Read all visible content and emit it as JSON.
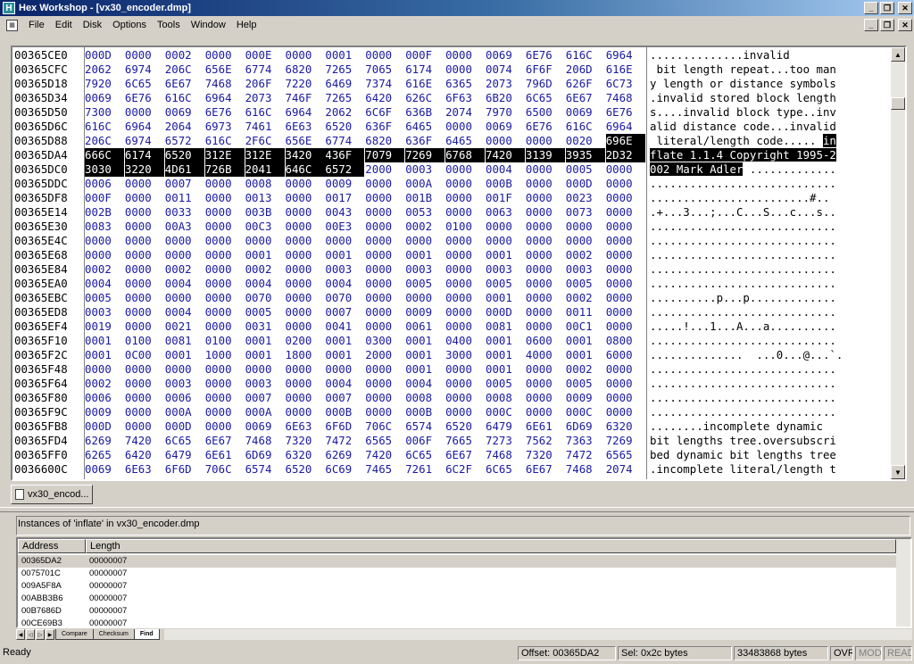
{
  "window": {
    "title": "Hex Workshop - [vx30_encoder.dmp]"
  },
  "menu": [
    "File",
    "Edit",
    "Disk",
    "Options",
    "Tools",
    "Window",
    "Help"
  ],
  "hex": {
    "rows": [
      {
        "addr": "00365CE0",
        "words": [
          "000D",
          "0000",
          "0002",
          "0000",
          "000E",
          "0000",
          "0001",
          "0000",
          "000F",
          "0000",
          "0069",
          "6E76",
          "616C",
          "6964"
        ],
        "ascii": "..............invalid"
      },
      {
        "addr": "00365CFC",
        "words": [
          "2062",
          "6974",
          "206C",
          "656E",
          "6774",
          "6820",
          "7265",
          "7065",
          "6174",
          "0000",
          "0074",
          "6F6F",
          "206D",
          "616E"
        ],
        "ascii": " bit length repeat...too man"
      },
      {
        "addr": "00365D18",
        "words": [
          "7920",
          "6C65",
          "6E67",
          "7468",
          "206F",
          "7220",
          "6469",
          "7374",
          "616E",
          "6365",
          "2073",
          "796D",
          "626F",
          "6C73"
        ],
        "ascii": "y length or distance symbols"
      },
      {
        "addr": "00365D34",
        "words": [
          "0069",
          "6E76",
          "616C",
          "6964",
          "2073",
          "746F",
          "7265",
          "6420",
          "626C",
          "6F63",
          "6B20",
          "6C65",
          "6E67",
          "7468"
        ],
        "ascii": ".invalid stored block length"
      },
      {
        "addr": "00365D50",
        "words": [
          "7300",
          "0000",
          "0069",
          "6E76",
          "616C",
          "6964",
          "2062",
          "6C6F",
          "636B",
          "2074",
          "7970",
          "6500",
          "0069",
          "6E76"
        ],
        "ascii": "s....invalid block type..inv"
      },
      {
        "addr": "00365D6C",
        "words": [
          "616C",
          "6964",
          "2064",
          "6973",
          "7461",
          "6E63",
          "6520",
          "636F",
          "6465",
          "0000",
          "0069",
          "6E76",
          "616C",
          "6964"
        ],
        "ascii": "alid distance code...invalid"
      },
      {
        "addr": "00365D88",
        "words": [
          "206C",
          "6974",
          "6572",
          "616C",
          "2F6C",
          "656E",
          "6774",
          "6820",
          "636F",
          "6465",
          "0000",
          "0000",
          "0020",
          "696E"
        ],
        "ascii": " literal/length code..... ",
        "ascii_sel": "in"
      },
      {
        "addr": "00365DA4",
        "words": [
          "666C",
          "6174",
          "6520",
          "312E",
          "312E",
          "3420",
          "436F",
          "7079",
          "7269",
          "6768",
          "7420",
          "3139",
          "3935",
          "2D32"
        ],
        "ascii": "",
        "ascii_sel": "flate 1.1.4 Copyright 1995-2"
      },
      {
        "addr": "00365DC0",
        "words": [
          "3030",
          "3220",
          "4D61",
          "726B",
          "2041",
          "646C",
          "6572",
          "2000",
          "0003",
          "0000",
          "0004",
          "0000",
          "0005",
          "0000"
        ],
        "ascii_sel": "002 Mark Adler",
        "ascii": " ............."
      },
      {
        "addr": "00365DDC",
        "words": [
          "0006",
          "0000",
          "0007",
          "0000",
          "0008",
          "0000",
          "0009",
          "0000",
          "000A",
          "0000",
          "000B",
          "0000",
          "000D",
          "0000"
        ],
        "ascii": "............................"
      },
      {
        "addr": "00365DF8",
        "words": [
          "000F",
          "0000",
          "0011",
          "0000",
          "0013",
          "0000",
          "0017",
          "0000",
          "001B",
          "0000",
          "001F",
          "0000",
          "0023",
          "0000"
        ],
        "ascii": "........................#.."
      },
      {
        "addr": "00365E14",
        "words": [
          "002B",
          "0000",
          "0033",
          "0000",
          "003B",
          "0000",
          "0043",
          "0000",
          "0053",
          "0000",
          "0063",
          "0000",
          "0073",
          "0000"
        ],
        "ascii": ".+...3...;...C...S...c...s.."
      },
      {
        "addr": "00365E30",
        "words": [
          "0083",
          "0000",
          "00A3",
          "0000",
          "00C3",
          "0000",
          "00E3",
          "0000",
          "0002",
          "0100",
          "0000",
          "0000",
          "0000",
          "0000"
        ],
        "ascii": "............................"
      },
      {
        "addr": "00365E4C",
        "words": [
          "0000",
          "0000",
          "0000",
          "0000",
          "0000",
          "0000",
          "0000",
          "0000",
          "0000",
          "0000",
          "0000",
          "0000",
          "0000",
          "0000"
        ],
        "ascii": "............................"
      },
      {
        "addr": "00365E68",
        "words": [
          "0000",
          "0000",
          "0000",
          "0000",
          "0001",
          "0000",
          "0001",
          "0000",
          "0001",
          "0000",
          "0001",
          "0000",
          "0002",
          "0000"
        ],
        "ascii": "............................"
      },
      {
        "addr": "00365E84",
        "words": [
          "0002",
          "0000",
          "0002",
          "0000",
          "0002",
          "0000",
          "0003",
          "0000",
          "0003",
          "0000",
          "0003",
          "0000",
          "0003",
          "0000"
        ],
        "ascii": "............................"
      },
      {
        "addr": "00365EA0",
        "words": [
          "0004",
          "0000",
          "0004",
          "0000",
          "0004",
          "0000",
          "0004",
          "0000",
          "0005",
          "0000",
          "0005",
          "0000",
          "0005",
          "0000"
        ],
        "ascii": "............................"
      },
      {
        "addr": "00365EBC",
        "words": [
          "0005",
          "0000",
          "0000",
          "0000",
          "0070",
          "0000",
          "0070",
          "0000",
          "0000",
          "0000",
          "0001",
          "0000",
          "0002",
          "0000"
        ],
        "ascii": "..........p...p............."
      },
      {
        "addr": "00365ED8",
        "words": [
          "0003",
          "0000",
          "0004",
          "0000",
          "0005",
          "0000",
          "0007",
          "0000",
          "0009",
          "0000",
          "000D",
          "0000",
          "0011",
          "0000"
        ],
        "ascii": "............................"
      },
      {
        "addr": "00365EF4",
        "words": [
          "0019",
          "0000",
          "0021",
          "0000",
          "0031",
          "0000",
          "0041",
          "0000",
          "0061",
          "0000",
          "0081",
          "0000",
          "00C1",
          "0000"
        ],
        "ascii": ".....!...1...A...a.........."
      },
      {
        "addr": "00365F10",
        "words": [
          "0001",
          "0100",
          "0081",
          "0100",
          "0001",
          "0200",
          "0001",
          "0300",
          "0001",
          "0400",
          "0001",
          "0600",
          "0001",
          "0800"
        ],
        "ascii": "............................"
      },
      {
        "addr": "00365F2C",
        "words": [
          "0001",
          "0C00",
          "0001",
          "1000",
          "0001",
          "1800",
          "0001",
          "2000",
          "0001",
          "3000",
          "0001",
          "4000",
          "0001",
          "6000"
        ],
        "ascii": "..............  ...0...@...`."
      },
      {
        "addr": "00365F48",
        "words": [
          "0000",
          "0000",
          "0000",
          "0000",
          "0000",
          "0000",
          "0000",
          "0000",
          "0001",
          "0000",
          "0001",
          "0000",
          "0002",
          "0000"
        ],
        "ascii": "............................"
      },
      {
        "addr": "00365F64",
        "words": [
          "0002",
          "0000",
          "0003",
          "0000",
          "0003",
          "0000",
          "0004",
          "0000",
          "0004",
          "0000",
          "0005",
          "0000",
          "0005",
          "0000"
        ],
        "ascii": "............................"
      },
      {
        "addr": "00365F80",
        "words": [
          "0006",
          "0000",
          "0006",
          "0000",
          "0007",
          "0000",
          "0007",
          "0000",
          "0008",
          "0000",
          "0008",
          "0000",
          "0009",
          "0000"
        ],
        "ascii": "............................"
      },
      {
        "addr": "00365F9C",
        "words": [
          "0009",
          "0000",
          "000A",
          "0000",
          "000A",
          "0000",
          "000B",
          "0000",
          "000B",
          "0000",
          "000C",
          "0000",
          "000C",
          "0000"
        ],
        "ascii": "............................"
      },
      {
        "addr": "00365FB8",
        "words": [
          "000D",
          "0000",
          "000D",
          "0000",
          "0069",
          "6E63",
          "6F6D",
          "706C",
          "6574",
          "6520",
          "6479",
          "6E61",
          "6D69",
          "6320"
        ],
        "ascii": "........incomplete dynamic "
      },
      {
        "addr": "00365FD4",
        "words": [
          "6269",
          "7420",
          "6C65",
          "6E67",
          "7468",
          "7320",
          "7472",
          "6565",
          "006F",
          "7665",
          "7273",
          "7562",
          "7363",
          "7269"
        ],
        "ascii": "bit lengths tree.oversubscri"
      },
      {
        "addr": "00365FF0",
        "words": [
          "6265",
          "6420",
          "6479",
          "6E61",
          "6D69",
          "6320",
          "6269",
          "7420",
          "6C65",
          "6E67",
          "7468",
          "7320",
          "7472",
          "6565"
        ],
        "ascii": "bed dynamic bit lengths tree"
      },
      {
        "addr": "0036600C",
        "words": [
          "0069",
          "6E63",
          "6F6D",
          "706C",
          "6574",
          "6520",
          "6C69",
          "7465",
          "7261",
          "6C2F",
          "6C65",
          "6E67",
          "7468",
          "2074"
        ],
        "ascii": ".incomplete literal/length t"
      }
    ]
  },
  "doc_tab": {
    "label": "vx30_encod..."
  },
  "results": {
    "title": "Instances of 'inflate' in vx30_encoder.dmp",
    "columns": [
      "Address",
      "Length"
    ],
    "rows": [
      {
        "address": "00365DA2",
        "length": "00000007"
      },
      {
        "address": "0075701C",
        "length": "00000007"
      },
      {
        "address": "009A5F8A",
        "length": "00000007"
      },
      {
        "address": "00ABB3B6",
        "length": "00000007"
      },
      {
        "address": "00B7686D",
        "length": "00000007"
      },
      {
        "address": "00CE69B3",
        "length": "00000007"
      }
    ],
    "tabs": [
      "Compare",
      "Checksum",
      "Find"
    ]
  },
  "status": {
    "ready": "Ready",
    "offset": "Offset: 00365DA2",
    "sel": "Sel: 0x2c bytes",
    "size": "33483868 bytes",
    "ovr": "OVR",
    "mod": "MOD",
    "read": "READ"
  }
}
